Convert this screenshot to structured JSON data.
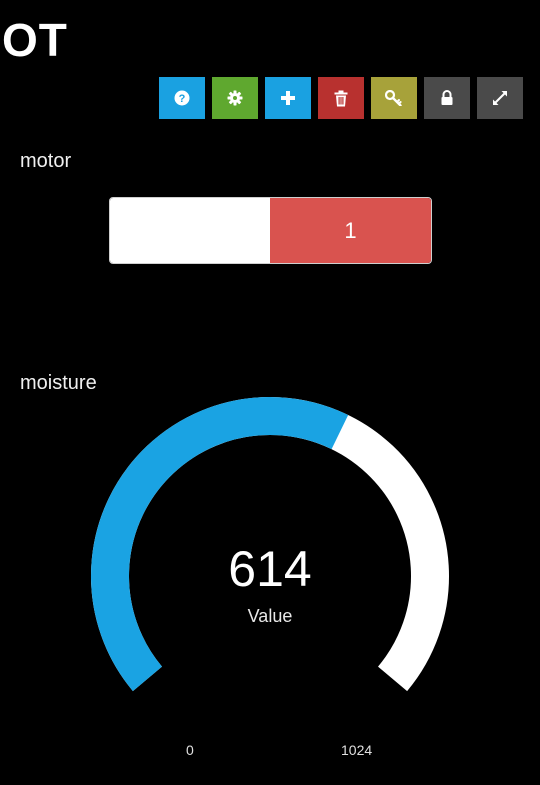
{
  "app": {
    "title": "OT"
  },
  "toolbar": {
    "buttons": [
      {
        "name": "help-button",
        "icon": "question-icon",
        "color": "#1aa1e1"
      },
      {
        "name": "settings-button",
        "icon": "gear-icon",
        "color": "#5fa82f"
      },
      {
        "name": "add-button",
        "icon": "plus-icon",
        "color": "#1aa1e1"
      },
      {
        "name": "delete-button",
        "icon": "trash-icon",
        "color": "#b8312f"
      },
      {
        "name": "key-button",
        "icon": "key-icon",
        "color": "#a7a23a"
      },
      {
        "name": "lock-button",
        "icon": "lock-icon",
        "color": "#4a4a4a"
      },
      {
        "name": "fullscreen-button",
        "icon": "expand-icon",
        "color": "#4a4a4a"
      }
    ]
  },
  "motor": {
    "label": "motor",
    "value": "1",
    "on_color": "#d9534f",
    "off_color": "#ffffff"
  },
  "moisture": {
    "label": "moisture",
    "value": 614,
    "value_text": "614",
    "caption": "Value",
    "min": 0,
    "max": 1024,
    "min_text": "0",
    "max_text": "1024",
    "fill_color": "#1aa3e3",
    "track_color": "#ffffff"
  }
}
